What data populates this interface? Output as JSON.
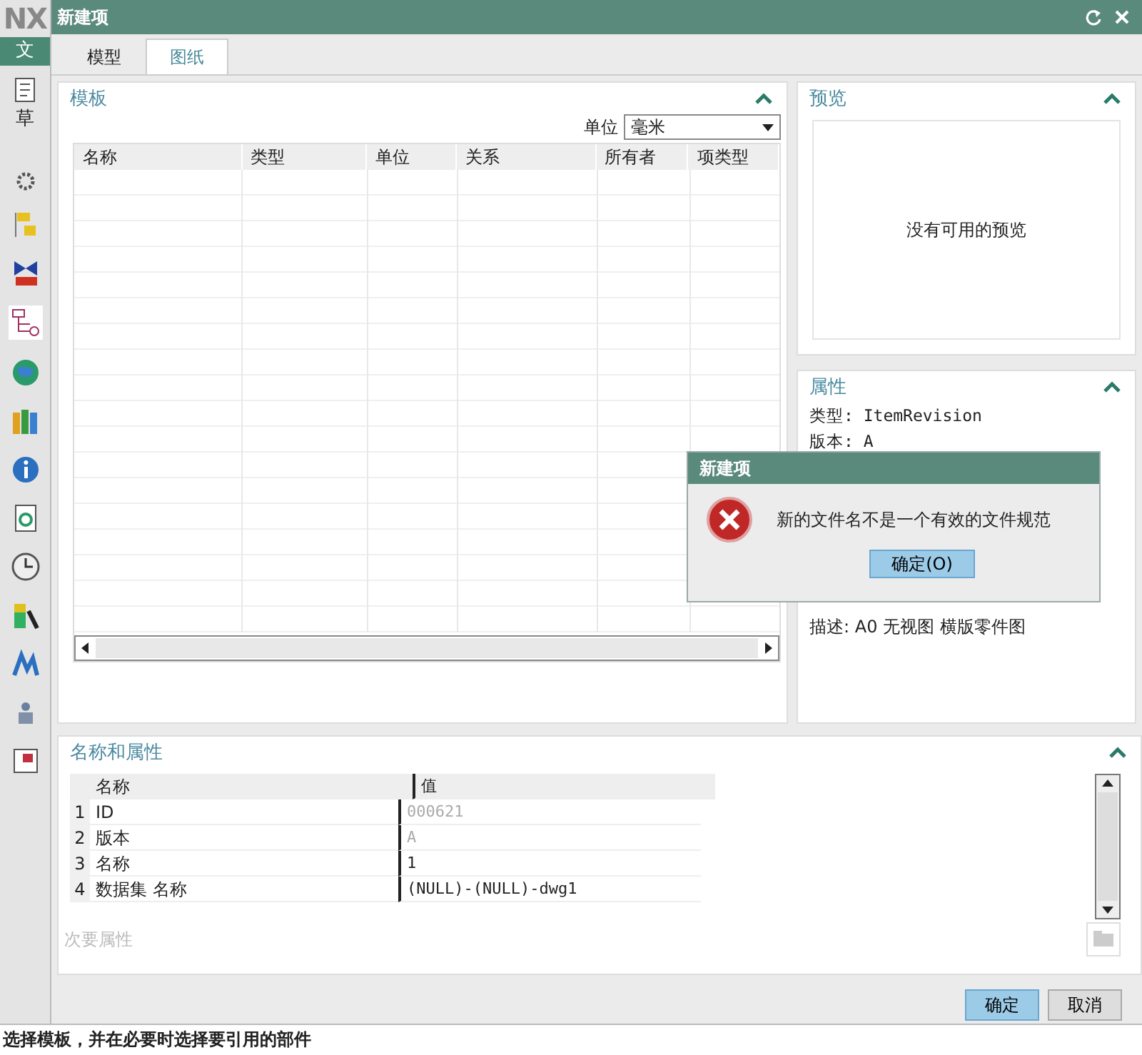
{
  "app": {
    "logo": "NX",
    "menu_tab": "文",
    "sketch_label": "草"
  },
  "window": {
    "title": "新建项"
  },
  "tabs": [
    {
      "label": "模型",
      "selected": false
    },
    {
      "label": "图纸",
      "selected": true
    }
  ],
  "template_panel": {
    "title": "模板",
    "unit_label": "单位",
    "unit_value": "毫米",
    "columns": [
      "名称",
      "类型",
      "单位",
      "关系",
      "所有者",
      "项类型"
    ]
  },
  "preview_panel": {
    "title": "预览",
    "message": "没有可用的预览"
  },
  "properties_panel": {
    "title": "属性",
    "lines": [
      "类型: ItemRevision",
      "版本: A"
    ],
    "description": "描述: A0 无视图 横版零件图"
  },
  "names_panel": {
    "title": "名称和属性",
    "columns": [
      "名称",
      "值"
    ],
    "rows": [
      {
        "index": "1",
        "name": "ID",
        "value": "000621",
        "disabled": true
      },
      {
        "index": "2",
        "name": "版本",
        "value": "A",
        "disabled": true
      },
      {
        "index": "3",
        "name": "名称",
        "value": "1",
        "disabled": false
      },
      {
        "index": "4",
        "name": "数据集 名称",
        "value": "(NULL)-(NULL)-dwg1",
        "disabled": false
      }
    ],
    "secondary_label": "次要属性"
  },
  "buttons": [
    {
      "label": "确定",
      "primary": true
    },
    {
      "label": "取消",
      "primary": false
    }
  ],
  "alert": {
    "title": "新建项",
    "message": "新的文件名不是一个有效的文件规范",
    "button": "确定(O)"
  },
  "status_bar": "选择模板，并在必要时选择要引用的部件"
}
